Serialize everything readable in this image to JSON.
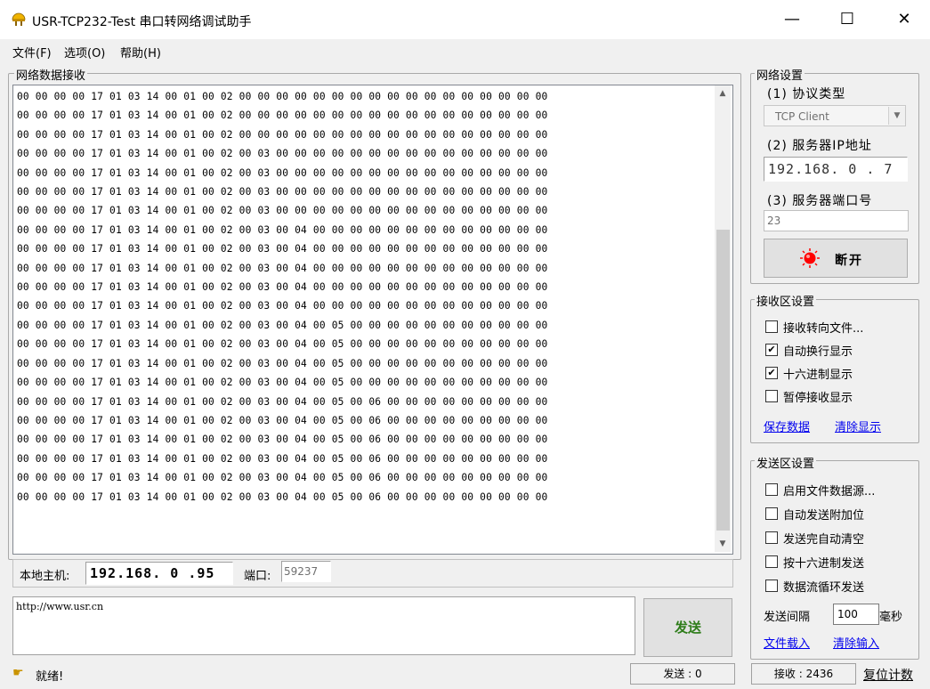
{
  "window": {
    "title": "USR-TCP232-Test 串口转网络调试助手",
    "minimize": "—",
    "maximize": "☐",
    "close": "✕"
  },
  "menu": [
    "文件(F)",
    "选项(O)",
    "帮助(H)"
  ],
  "receive": {
    "title": "网络数据接收",
    "lines": [
      "00 00 00 00 17 01 03 14 00 01 00 02 00 00 00 00 00 00 00 00 00 00 00 00 00 00 00 00 00",
      "00 00 00 00 17 01 03 14 00 01 00 02 00 00 00 00 00 00 00 00 00 00 00 00 00 00 00 00 00",
      "00 00 00 00 17 01 03 14 00 01 00 02 00 00 00 00 00 00 00 00 00 00 00 00 00 00 00 00 00",
      "00 00 00 00 17 01 03 14 00 01 00 02 00 03 00 00 00 00 00 00 00 00 00 00 00 00 00 00 00",
      "00 00 00 00 17 01 03 14 00 01 00 02 00 03 00 00 00 00 00 00 00 00 00 00 00 00 00 00 00",
      "00 00 00 00 17 01 03 14 00 01 00 02 00 03 00 00 00 00 00 00 00 00 00 00 00 00 00 00 00",
      "00 00 00 00 17 01 03 14 00 01 00 02 00 03 00 00 00 00 00 00 00 00 00 00 00 00 00 00 00",
      "00 00 00 00 17 01 03 14 00 01 00 02 00 03 00 04 00 00 00 00 00 00 00 00 00 00 00 00 00",
      "00 00 00 00 17 01 03 14 00 01 00 02 00 03 00 04 00 00 00 00 00 00 00 00 00 00 00 00 00",
      "00 00 00 00 17 01 03 14 00 01 00 02 00 03 00 04 00 00 00 00 00 00 00 00 00 00 00 00 00",
      "00 00 00 00 17 01 03 14 00 01 00 02 00 03 00 04 00 00 00 00 00 00 00 00 00 00 00 00 00",
      "00 00 00 00 17 01 03 14 00 01 00 02 00 03 00 04 00 00 00 00 00 00 00 00 00 00 00 00 00",
      "00 00 00 00 17 01 03 14 00 01 00 02 00 03 00 04 00 05 00 00 00 00 00 00 00 00 00 00 00",
      "00 00 00 00 17 01 03 14 00 01 00 02 00 03 00 04 00 05 00 00 00 00 00 00 00 00 00 00 00",
      "00 00 00 00 17 01 03 14 00 01 00 02 00 03 00 04 00 05 00 00 00 00 00 00 00 00 00 00 00",
      "00 00 00 00 17 01 03 14 00 01 00 02 00 03 00 04 00 05 00 00 00 00 00 00 00 00 00 00 00",
      "00 00 00 00 17 01 03 14 00 01 00 02 00 03 00 04 00 05 00 06 00 00 00 00 00 00 00 00 00",
      "00 00 00 00 17 01 03 14 00 01 00 02 00 03 00 04 00 05 00 06 00 00 00 00 00 00 00 00 00",
      "00 00 00 00 17 01 03 14 00 01 00 02 00 03 00 04 00 05 00 06 00 00 00 00 00 00 00 00 00",
      "00 00 00 00 17 01 03 14 00 01 00 02 00 03 00 04 00 05 00 06 00 00 00 00 00 00 00 00 00",
      "00 00 00 00 17 01 03 14 00 01 00 02 00 03 00 04 00 05 00 06 00 00 00 00 00 00 00 00 00",
      "00 00 00 00 17 01 03 14 00 01 00 02 00 03 00 04 00 05 00 06 00 00 00 00 00 00 00 00 00"
    ]
  },
  "local": {
    "host_label": "本地主机:",
    "host_ip": "192.168. 0 .95",
    "port_label": "端口:",
    "port_value": "59237"
  },
  "send": {
    "text": "http://www.usr.cn",
    "button": "发送"
  },
  "network": {
    "title": "网络设置",
    "protocol_label": "(1) 协议类型",
    "protocol_value": "TCP Client",
    "server_ip_label": "(2) 服务器IP地址",
    "server_ip": "192.168. 0 . 7",
    "server_port_label": "(3) 服务器端口号",
    "server_port": "23",
    "disconnect": "断开"
  },
  "recv_settings": {
    "title": "接收区设置",
    "options": [
      {
        "label": "接收转向文件...",
        "checked": false
      },
      {
        "label": "自动换行显示",
        "checked": true
      },
      {
        "label": "十六进制显示",
        "checked": true
      },
      {
        "label": "暂停接收显示",
        "checked": false
      }
    ],
    "save": "保存数据",
    "clear": "清除显示"
  },
  "send_settings": {
    "title": "发送区设置",
    "options": [
      {
        "label": "启用文件数据源...",
        "checked": false
      },
      {
        "label": "自动发送附加位",
        "checked": false
      },
      {
        "label": "发送完自动清空",
        "checked": false
      },
      {
        "label": "按十六进制发送",
        "checked": false
      },
      {
        "label": "数据流循环发送",
        "checked": false
      }
    ],
    "interval_label": "发送间隔",
    "interval_value": "100",
    "interval_unit": "毫秒",
    "load_file": "文件载入",
    "clear_input": "清除输入"
  },
  "status": {
    "ready": "就绪!",
    "sent": "发送 : 0",
    "received": "接收 : 2436",
    "reset": "复位计数"
  },
  "colors": {
    "accent_green": "#2e7d1a",
    "indicator_red": "#ff0000",
    "link": "#0000ee"
  }
}
